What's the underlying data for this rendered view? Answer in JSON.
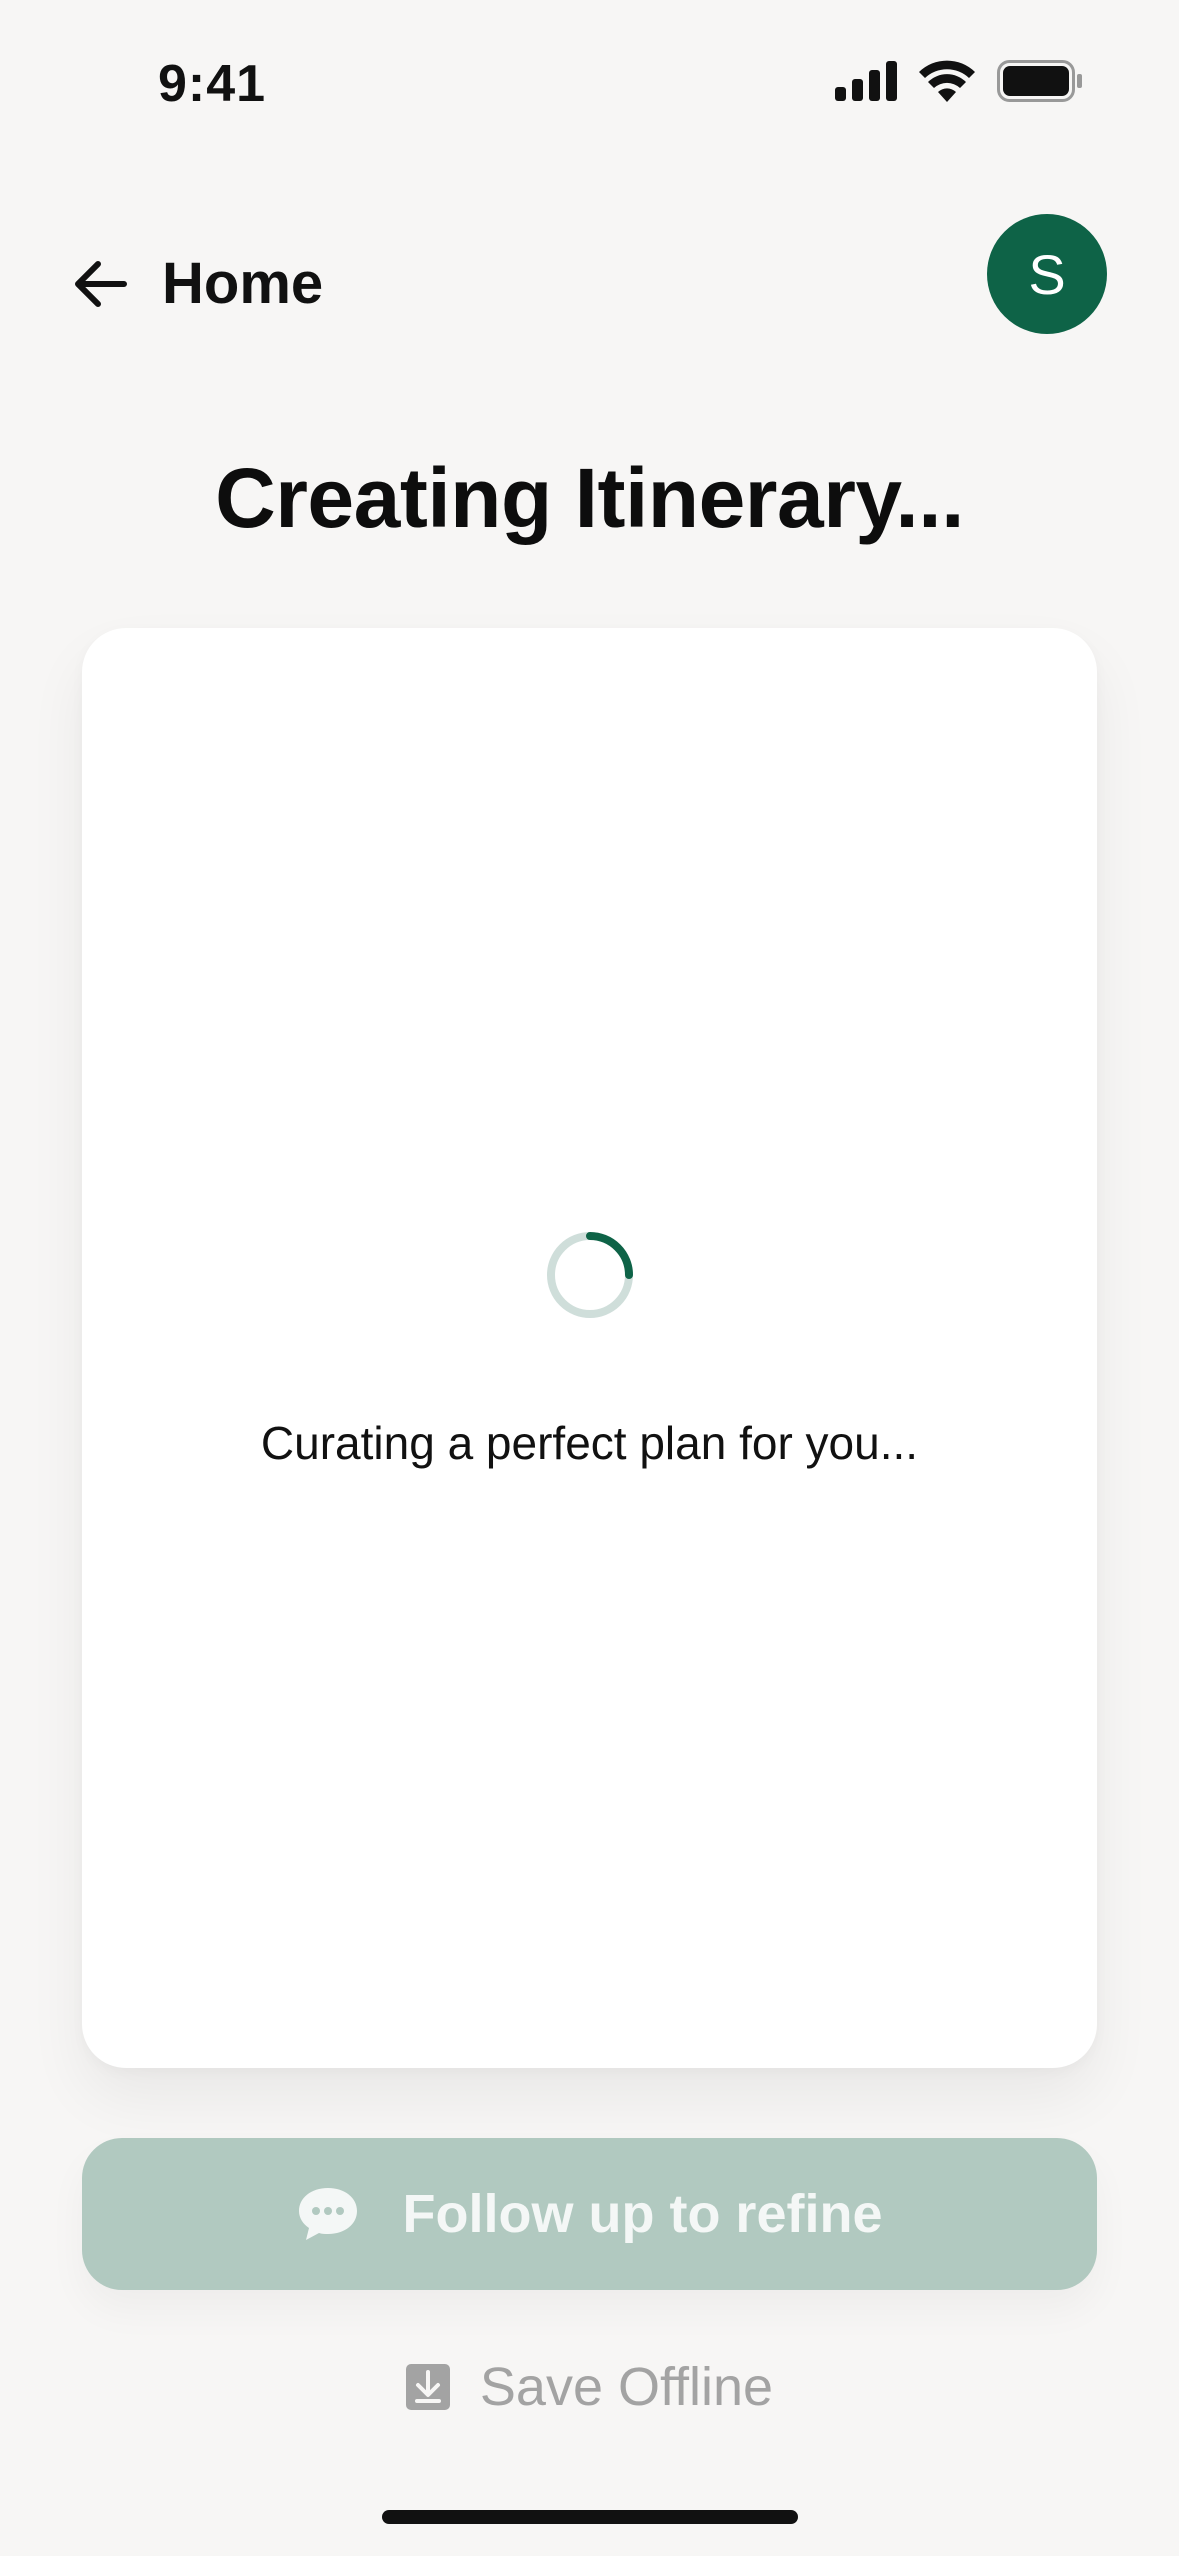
{
  "status_bar": {
    "time": "9:41"
  },
  "header": {
    "back_label": "Home",
    "avatar_initial": "S"
  },
  "title": "Creating Itinerary...",
  "loading": {
    "message": "Curating a perfect plan for you..."
  },
  "actions": {
    "follow_up_label": "Follow up to refine",
    "save_offline_label": "Save Offline"
  },
  "icons": {
    "back": "arrow-left-icon",
    "chat": "chat-bubble-icon",
    "download": "download-icon",
    "signal": "signal-icon",
    "wifi": "wifi-icon",
    "battery": "battery-icon"
  },
  "colors": {
    "accent": "#0e6347",
    "follow_up_bg": "#b1c9c0",
    "background": "#f7f6f5",
    "muted_text": "#a3a3a3"
  }
}
